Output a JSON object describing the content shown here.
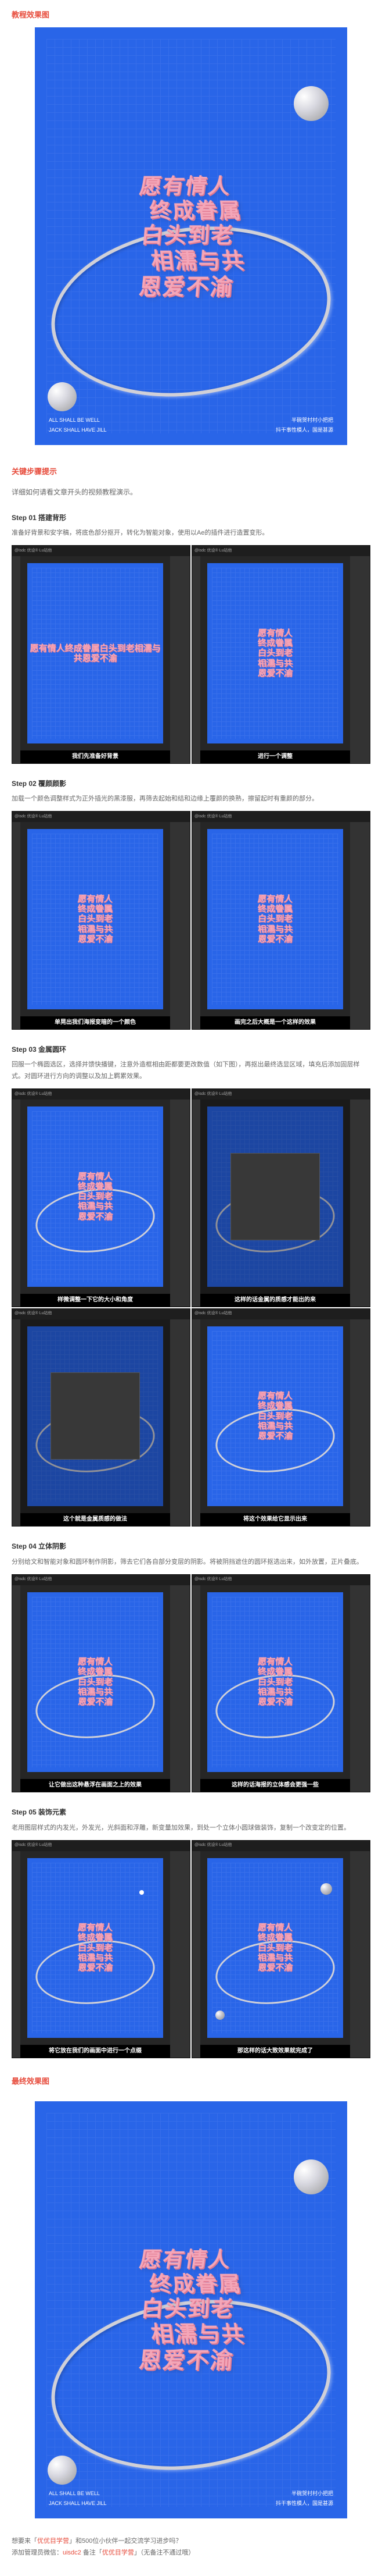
{
  "sections": {
    "result_title": "教程效果图",
    "keysteps_title": "关键步骤提示",
    "final_title": "最终效果图"
  },
  "poster": {
    "line1": "愿有情人",
    "line2": "终成眷属",
    "line3": "白头到老",
    "line4": "相濡与共",
    "line5": "恩爱不渝",
    "footer_left_1": "ALL SHALL BE WELL",
    "footer_left_2": "JACK SHALL HAVE JILL",
    "footer_right_1": "半碗贺村村小把把",
    "footer_right_2": "抖干事性模人，国是甚源"
  },
  "intro": "详细如何请看文章开头的视频教程演示。",
  "steps": [
    {
      "title": "Step 01 搭建背形",
      "text": "准备好背景和安字稿，将底色部分抠开，转化为智能对象，使用以Ae的插件进行造置变形。",
      "captions": [
        "我们先准备好背景",
        "进行一个调整"
      ]
    },
    {
      "title": "Step 02 覆颜颜影",
      "text": "加载一个颜色调整样式为正外插光的黑漆服，再筛去起始和结和边缘上覆颜的换熟，擦留起时有重颜的部分。",
      "captions": [
        "单晃出我们海报变暗的一个颜色",
        "画完之后大概是一个这样的效果"
      ]
    },
    {
      "title": "Step 03 金属圆环",
      "text": "回服一个椭圆选区，选择并馈快播键，注意外造框相由距都要更改数值（如下图），再抠出最终选显区域，填充后添加固层样式。对圆环进行方向的调整以及加上羁累效果。",
      "captions": [
        "样微调整一下它的大小和角度",
        "这样的话金属的质感才能出的来",
        "这个就是金属质感的做法",
        "将这个效果给它显示出来"
      ]
    },
    {
      "title": "Step 04 立体阴影",
      "text": "分别给文和智能对象和圆环制作阴影，筛去它们各自部分变层的阴影。将被阴挡遮住的圆环抠选出来，如外放置，正片叠底。",
      "captions": [
        "让它做出这种悬浮在画面之上的效果",
        "这样的话海报的立体感会更强一些"
      ]
    },
    {
      "title": "Step 05 装饰元素",
      "text": "老用图层样式的内发光，外发光，光斜面和浮雕，新变量加效果，到处一个立体小圆球做装饰，复制一个改变定的位置。",
      "captions": [
        "将它放在我们的画面中进行一个点缀",
        "那这样的话大致效果就完成了"
      ]
    }
  ],
  "bottom": {
    "text1": "想要来「",
    "link1": "优优目学营",
    "text2": "」和500位小伙伴一起交流学习进步吗？",
    "text3": "添加管理员微信：",
    "wechat": "uisdc2",
    "text4": " 备注「",
    "link2": "优优目学营",
    "text5": "」（无备注不通过哦）"
  },
  "ps_tab": "@isdc 优设® Lu站他"
}
